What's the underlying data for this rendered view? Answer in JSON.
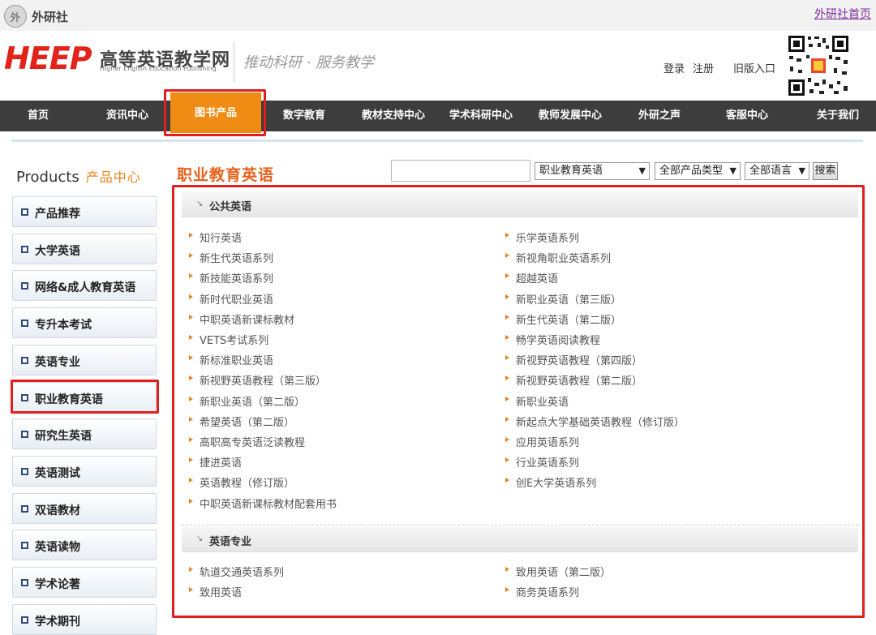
{
  "topbar": {
    "logo_text": "外研社",
    "logo_mark": "外",
    "home_link": "外研社首页"
  },
  "header": {
    "brand": "HEEP",
    "brand_cn": "高等英语教学网",
    "brand_en": "Higher English Education Publishing",
    "slogan": "推动科研 · 服务教学",
    "login": "登录",
    "register": "注册",
    "old_entry": "旧版入口"
  },
  "nav": {
    "items": [
      "首页",
      "资讯中心",
      "图书产品",
      "数字教育",
      "教材支持中心",
      "学术科研中心",
      "教师发展中心",
      "外研之声",
      "客服中心",
      "关于我们"
    ],
    "active": "图书产品"
  },
  "sidebar": {
    "title_en": "Products",
    "title_cn": "产品中心",
    "items": [
      "产品推荐",
      "大学英语",
      "网络&成人教育英语",
      "专升本考试",
      "英语专业",
      "职业教育英语",
      "研究生英语",
      "英语测试",
      "双语教材",
      "英语读物",
      "学术论著",
      "学术期刊"
    ],
    "selected": "职业教育英语"
  },
  "main": {
    "title": "职业教育英语",
    "search": {
      "value": "",
      "select_category": "职业教育英语",
      "select_type": "全部产品类型",
      "select_language": "全部语言",
      "button": "搜索"
    },
    "sections": [
      {
        "title": "公共英语",
        "left": [
          "知行英语",
          "新生代英语系列",
          "新技能英语系列",
          "新时代职业英语",
          "中职英语新课标教材",
          "VETS考试系列",
          "新标准职业英语",
          "新视野英语教程（第三版）",
          "新职业英语（第二版）",
          "希望英语（第二版）",
          "高职高专英语泛读教程",
          "捷进英语",
          "英语教程（修订版）",
          "中职英语新课标教材配套用书"
        ],
        "right": [
          "乐学英语系列",
          "新视角职业英语系列",
          "超越英语",
          "新职业英语（第三版）",
          "新生代英语（第二版）",
          "畅学英语阅读教程",
          "新视野英语教程（第四版）",
          "新视野英语教程（第二版）",
          "新职业英语",
          "新起点大学基础英语教程（修订版）",
          "应用英语系列",
          "行业英语系列",
          "创E大学英语系列"
        ]
      },
      {
        "title": "英语专业",
        "left": [
          "轨道交通英语系列",
          "致用英语"
        ],
        "right": [
          "致用英语（第二版）",
          "商务英语系列"
        ]
      }
    ]
  },
  "icons": {
    "section_arrow": "arrow-down-right-icon",
    "list_bullet": "triangle-right-icon",
    "side_bullet": "square-bullet-icon"
  },
  "colors": {
    "brand_red": "#e2231a",
    "accent_orange": "#f08b14",
    "nav_bg": "#3d3d3d",
    "highlight_red": "#e0201c"
  }
}
